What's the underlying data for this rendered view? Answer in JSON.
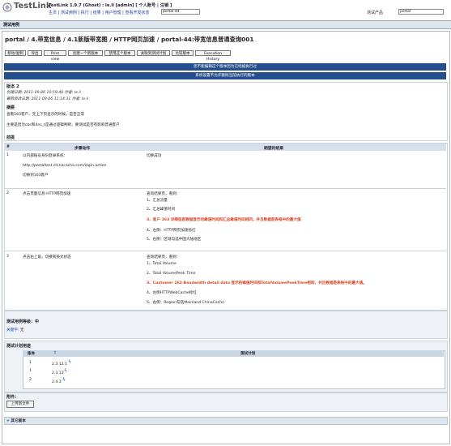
{
  "header": {
    "logo_text": "TestLink",
    "version": "TestLink 1.9.7 (Ghost) : le.li [admin] [ 个人账号 | 注销 ]",
    "nav": [
      "主页",
      "测试用例",
      "执行",
      "结果",
      "用户管理",
      "查看开发状态"
    ],
    "search_value": "portal-44",
    "project_label": "测试产品",
    "project_value": "portal"
  },
  "section_title": "测试用例",
  "testcase": {
    "title": "portal / 4.带宽信息 / 4.1新版带宽图 / HTTP网页加速 / portal-44:带宽信息普通查询001",
    "toolbar": [
      "移动/复制",
      "导出",
      "Print view",
      "创建一个新版本",
      "禁用这个版本",
      "关联到测试计划",
      "比较版本",
      "Execution History"
    ],
    "warning1": "您不能编辑这个版本因为已经被执行过",
    "warning2": "系统设置不允许删除当前执行的版本",
    "version_label": "版本 2",
    "created": "创建日期: 2011-09-06 10:59:40  作者: le.li",
    "modified": "最后修改日期: 2011-09-06 11:14:31  作者: le.li",
    "summary_label": "摘要",
    "summary_line1": "查看163客户，无上下页显示的时候，是否正常",
    "summary_line2": "主要是因为cbc和dns_t是通过逻辑判断，要测试是否有影响普通客户",
    "precond_label": "前提"
  },
  "steps": {
    "headers": [
      "#",
      "步骤动作",
      "期望的结果"
    ],
    "rows": [
      {
        "num": "1",
        "action": [
          "以内部账号身份登录系统：",
          "http://portaltest.chinacache.com/login.action",
          "切换到163客户"
        ],
        "expected": [
          "切换成功"
        ]
      },
      {
        "num": "2",
        "action": [
          "点击页面信息-HTTP网页加速"
        ],
        "expected": [
          "查询结果页，看到：",
          "1、汇总流量",
          "2、汇总峰值时间",
          "3、客户 163 详细信息数据显示的峰值时间和汇总峰值时间相同，并且数据是表格中的最大值",
          "4、左侧：HTTP网页加速标红",
          "5、右侧：区域勾选中国大陆地区"
        ]
      },
      {
        "num": "3",
        "action": [
          "点击右上角，切换到英文状态"
        ],
        "expected": [
          "查询结果页，看到：",
          "1、Total Volume",
          "2、Total VolumePeek Time",
          "3、Customer 163 Bandwidth detail data 显示的峰值时间和TotalVolumePeekTime相同，并且数据是表格中的最大值。",
          "4、左侧HTTPWebCache标红",
          "5、右侧：Region勾选Mainland ChinaCache"
        ]
      }
    ]
  },
  "importance": "测试用例等级：中",
  "keywords_label": "关键字:",
  "keywords_value": "无",
  "plans": {
    "label": "测试计划用途",
    "headers": [
      "版本",
      "测试计划"
    ],
    "rows": [
      {
        "version": "1",
        "plan": "2.3.12.1"
      },
      {
        "version": "1",
        "plan": "2.3.13"
      },
      {
        "version": "2",
        "plan": "2.4.3"
      }
    ]
  },
  "attachments_label": "附件：",
  "upload_label": "上传新文件",
  "other_versions": "其它版本",
  "colors": {
    "warning_bar": "#254f8c",
    "header_bg": "#d7e0ea",
    "highlight": "#dd4422"
  }
}
